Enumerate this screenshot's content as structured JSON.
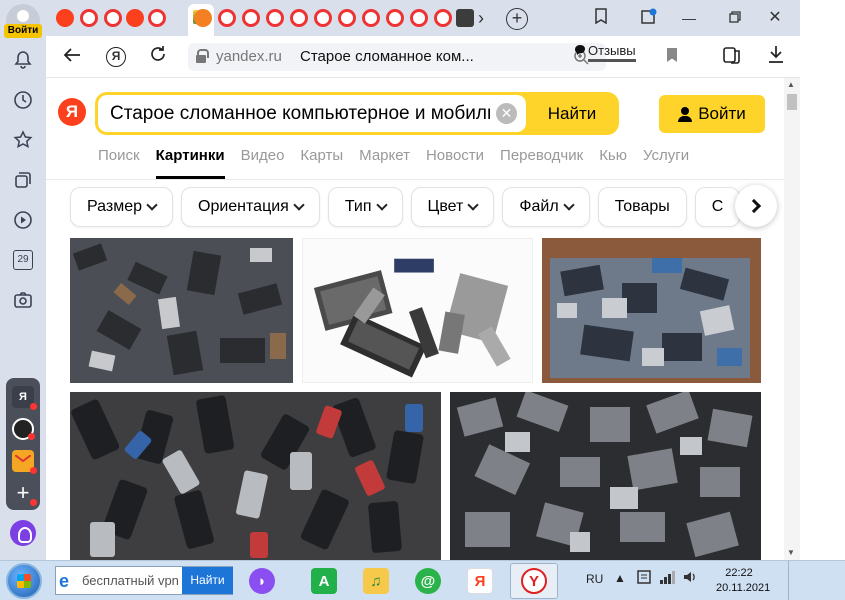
{
  "sidebar": {
    "login_label": "Войти",
    "calendar_day": "29",
    "icons": [
      "bell-icon",
      "history-icon",
      "star-icon",
      "collections-icon",
      "play-icon",
      "calendar-icon",
      "camera-icon"
    ],
    "apps": [
      {
        "name": "yandex-app",
        "glyph": "Я",
        "color": "#3a3f4a"
      },
      {
        "name": "camera-app",
        "glyph": "◉",
        "color": "#222"
      },
      {
        "name": "mail-app",
        "glyph": "✉",
        "color": "#f5a623"
      },
      {
        "name": "add-app",
        "glyph": "+",
        "color": "#4a4f5a"
      }
    ]
  },
  "tabs": {
    "new_tab_glyph": "+",
    "more_glyph": "›"
  },
  "toolbar": {
    "host": "yandex.ru",
    "title": "Старое сломанное компьютерное и моби",
    "title_display": "Старое сломанное ком...",
    "reviews_label": "Отзывы"
  },
  "search": {
    "logo": "Я",
    "query": "Старое сломанное компьютерное и мобильное",
    "button": "Найти",
    "login": "Войти"
  },
  "services": [
    "Поиск",
    "Картинки",
    "Видео",
    "Карты",
    "Маркет",
    "Новости",
    "Переводчик",
    "Кью",
    "Услуги"
  ],
  "active_service": "Картинки",
  "filters": [
    {
      "label": "Размер",
      "dropdown": true
    },
    {
      "label": "Ориентация",
      "dropdown": true
    },
    {
      "label": "Тип",
      "dropdown": true
    },
    {
      "label": "Цвет",
      "dropdown": true
    },
    {
      "label": "Файл",
      "dropdown": true
    },
    {
      "label": "Товары",
      "dropdown": false
    },
    {
      "label": "С",
      "dropdown": false
    }
  ],
  "results": [
    {
      "name": "result-image-phones-pile-1",
      "alt": "pile of old phones"
    },
    {
      "name": "result-image-laptops",
      "alt": "broken laptops and phones"
    },
    {
      "name": "result-image-ewaste-bin",
      "alt": "e-waste container"
    },
    {
      "name": "result-image-phones-pile-2",
      "alt": "pile of mobile phones"
    },
    {
      "name": "result-image-circuit-boards",
      "alt": "pile of drives and boards"
    }
  ],
  "taskbar": {
    "search_placeholder": "бесплатный vpn",
    "search_button": "Найти",
    "language": "RU",
    "time": "22:22",
    "date": "20.11.2021"
  },
  "colors": {
    "yandex_red": "#fc3f1d",
    "yandex_yellow": "#fed42b",
    "sidebar_bg": "#d9e0ec"
  }
}
